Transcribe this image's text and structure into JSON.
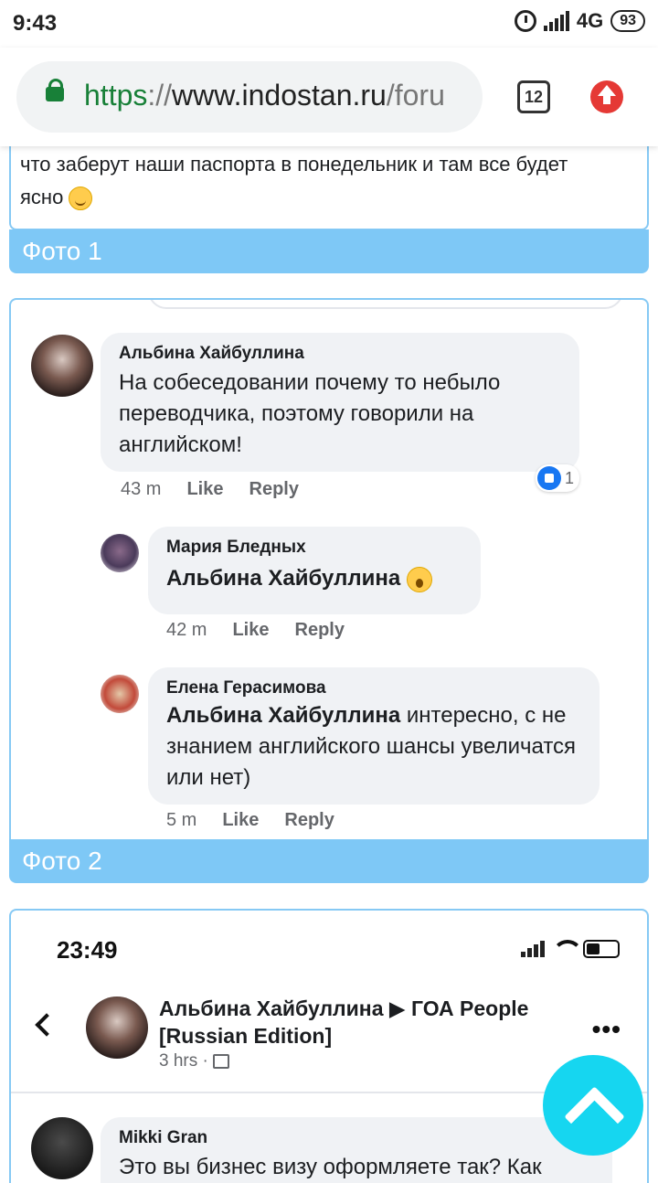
{
  "status_bar": {
    "time": "9:43",
    "network": "4G",
    "battery": "93"
  },
  "browser": {
    "url_scheme": "https",
    "url_sep": "://",
    "url_host": "www.indostan.ru",
    "url_path": "/foru",
    "tab_count": "12"
  },
  "post_intro": {
    "text": "что заберут наши паспорта в понедельник и там все будет ясно"
  },
  "captions": {
    "photo1": "Фото 1",
    "photo2": "Фото 2"
  },
  "comments": [
    {
      "author": "Альбина Хайбуллина",
      "text": "На собеседовании почему то небыло переводчика, поэтому говорили на английском!",
      "time": "43 m",
      "like": "Like",
      "reply": "Reply",
      "likes": "1"
    },
    {
      "author": "Мария Бледных",
      "mention": "Альбина Хайбуллина",
      "text": "",
      "time": "42 m",
      "like": "Like",
      "reply": "Reply"
    },
    {
      "author": "Елена Герасимова",
      "mention": "Альбина Хайбуллина",
      "text": " интересно, с не знанием английского шансы увеличатся или нет)",
      "time": "5 m",
      "like": "Like",
      "reply": "Reply"
    }
  ],
  "photo2": {
    "time": "23:49",
    "post_author": "Альбина Хайбуллина ▶ ГОА People [Russian Edition]",
    "post_time": "3 hrs ·",
    "comment_author": "Mikki Gran",
    "comment_text": "Это вы бизнес визу оформляете так? Как"
  }
}
